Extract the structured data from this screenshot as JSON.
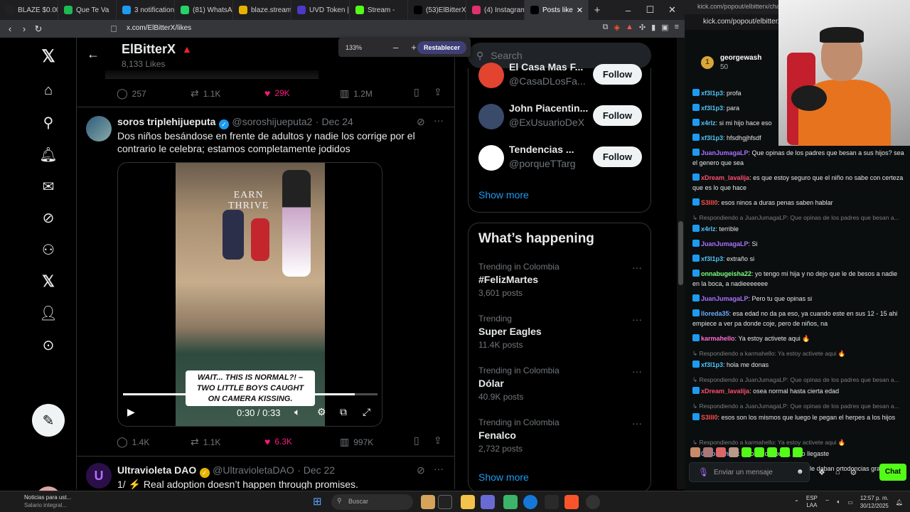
{
  "browser": {
    "tabs": [
      {
        "label": "BLAZE $0.00$",
        "color": "#222"
      },
      {
        "label": "Que Te Va",
        "color": "#1db954"
      },
      {
        "label": "3 notifications",
        "color": "#1d9bf0"
      },
      {
        "label": "(81) WhatsAp",
        "color": "#25d366"
      },
      {
        "label": "blaze.stream/",
        "color": "#e8b100"
      },
      {
        "label": "UVD Token |",
        "color": "#4b39c7"
      },
      {
        "label": "Stream -",
        "color": "#53fc18"
      },
      {
        "label": "(53)ElBitterX",
        "color": "#000"
      },
      {
        "label": "(4) Instagram",
        "color": "#e1306c"
      },
      {
        "label": "Posts like",
        "color": "#000"
      }
    ],
    "url": "x.com/ElBitterX/likes",
    "zoom": "133%",
    "zoom_reset": "Restablecer"
  },
  "profile": {
    "name": "ElBitterX",
    "likes_count": "8,133 Likes"
  },
  "prev_tweet_actions": {
    "replies": "257",
    "reposts": "1.1K",
    "likes": "29K",
    "views": "1.2M"
  },
  "tweet": {
    "name": "soros triplehijueputa",
    "handle": "@soroshijueputa2",
    "date": "· Dec 24",
    "text_line1": "Dos niños besándose en frente  de adultos y nadie los corrige por el",
    "text_line2": "contrario le celebra; estamos completamente jodidos",
    "video": {
      "overlay_line1": "EARN",
      "overlay_line2": "THRIVE",
      "caption_line1": "WAIT... THIS IS NORMAL?! –",
      "caption_line2": "TWO LITTLE BOYS CAUGHT",
      "caption_line3": "ON CAMERA KISSING.",
      "time": "0:30 / 0:33",
      "progress": 0.91
    },
    "actions": {
      "replies": "1.4K",
      "reposts": "1.1K",
      "likes": "6.3K",
      "views": "997K"
    }
  },
  "next_tweet": {
    "name": "Ultravioleta DAO",
    "handle": "@UltravioletaDAO",
    "date": "· Dec 22",
    "text": "1/ ⚡ Real adoption doesn’t happen through promises."
  },
  "sidebar": {
    "search_placeholder": "Search",
    "who_to_follow": [
      {
        "name": "El Casa Mas F...",
        "handle": "@CasaDLosFa...",
        "color": "#e2442f"
      },
      {
        "name": "John Piacentin...",
        "handle": "@ExUsuarioDeX",
        "color": "#3a4a6b"
      },
      {
        "name": "Tendencias ...",
        "handle": "@porqueTTarg",
        "color": "#ffffff"
      }
    ],
    "follow_label": "Follow",
    "show_more": "Show more",
    "happening_title": "What’s happening",
    "trends": [
      {
        "context": "Trending in Colombia",
        "topic": "#FelizMartes",
        "posts": "3,601 posts"
      },
      {
        "context": "Trending",
        "topic": "Super Eagles",
        "posts": "11.4K posts"
      },
      {
        "context": "Trending in Colombia",
        "topic": "Dólar",
        "posts": "40.9K posts"
      },
      {
        "context": "Trending in Colombia",
        "topic": "Fenalco",
        "posts": "2,732 posts"
      }
    ],
    "show_more_2": "Show more"
  },
  "kick": {
    "addr_top": "kick.com/popout/elbitterx/chat",
    "addr": "kick.com/popout/elbitterx",
    "gifter_name": "georgewash",
    "gifter_points": "50",
    "gifter_rank": "1",
    "messages": [
      {
        "user": "xf3l1p3",
        "text": "profa",
        "color": "#4fc3f7",
        "reply": false
      },
      {
        "user": "xf3l1p3",
        "text": "para",
        "color": "#4fc3f7",
        "reply": false
      },
      {
        "user": "x4rlz",
        "text": "si mi hijo hace eso",
        "color": "#4fc3f7",
        "reply": false
      },
      {
        "user": "xf3l1p3",
        "text": "hfsdhgjhfsdf",
        "color": "#4fc3f7",
        "reply": false
      },
      {
        "user": "JuanJumagaLP",
        "text": "Que opinas de los padres que besan a sus hijos? sea el genero que sea",
        "color": "#a970ff",
        "reply": false
      },
      {
        "user": "xDream_lavalija",
        "text": "es que estoy seguro que el niño no sabe con certeza que es lo que hace",
        "color": "#ff4d6d",
        "reply": false
      },
      {
        "user": "S3lll0",
        "text": "esos ninos a duras penas saben hablar",
        "color": "#ff4d4d",
        "reply": false
      },
      {
        "user": "",
        "text": "Respondiendo a JuanJumagaLP: Que opinas de los padres que besan a...",
        "color": "#888",
        "reply": true
      },
      {
        "user": "x4rlz",
        "text": "terrible",
        "color": "#4fc3f7",
        "reply": false
      },
      {
        "user": "JuanJumagaLP",
        "text": "Si",
        "color": "#a970ff",
        "reply": false
      },
      {
        "user": "xf3l1p3",
        "text": "extraño si",
        "color": "#4fc3f7",
        "reply": false
      },
      {
        "user": "onnabugeisha22",
        "text": "yo tengo mi hija y no dejo que le de besos a nadie en la boca, a nadieeeeeee",
        "color": "#7dff7d",
        "reply": false
      },
      {
        "user": "JuanJumagaLP",
        "text": "Pero tu que opinas si",
        "color": "#a970ff",
        "reply": false
      },
      {
        "user": "lloreda35",
        "text": "esa edad no da pa eso, ya cuando este en sus 12 - 15 ahi empiece a ver pa donde coje, pero de niños, na",
        "color": "#6fa8ff",
        "reply": false
      },
      {
        "user": "karmahello",
        "text": "Ya estoy activete aqui 🔥",
        "color": "#ff6bd5",
        "reply": false
      },
      {
        "user": "",
        "text": "Respondiendo a karmahello: Ya estoy activete aqui 🔥",
        "color": "#888",
        "reply": true
      },
      {
        "user": "xf3l1p3",
        "text": "hola me donas",
        "color": "#4fc3f7",
        "reply": false
      },
      {
        "user": "",
        "text": "Respondiendo a JuanJumagaLP: Que opinas de los padres que besan a...",
        "color": "#888",
        "reply": true
      },
      {
        "user": "xDream_lavalija",
        "text": "osea normal hasta cierta edad",
        "color": "#ff4d6d",
        "reply": false
      },
      {
        "user": "",
        "text": "Respondiendo a JuanJumagaLP: Que opinas de los padres que besan a...",
        "color": "#888",
        "reply": true
      },
      {
        "user": "S3lll0",
        "text": "esos son los mismos que luego le pegan el herpes a los hijos",
        "color": "#ff4d4d",
        "reply": false
      },
      {
        "user": "",
        "text": "Respondiendo a karmahello: Ya estoy activete aqui 🔥",
        "color": "#888",
        "reply": true
      },
      {
        "user": "0xsoulchain",
        "text": "2 horas después, pero llegaste",
        "color": "#6fa8ff",
        "reply": false
      },
      {
        "user": "lloreda35",
        "text": "al Bitter no le daban picos, le daban ortodoncias gratis",
        "color": "#6fa8ff",
        "reply": false
      }
    ],
    "input_placeholder": "Enviar un mensaje",
    "chat_button": "Chat"
  },
  "taskbar": {
    "news_title": "Noticias para ust...",
    "news_sub": "Salario integral...",
    "search": "Buscar",
    "lang1": "ESP",
    "lang2": "LAA",
    "time": "12:57 p. m.",
    "date": "30/12/2025"
  }
}
